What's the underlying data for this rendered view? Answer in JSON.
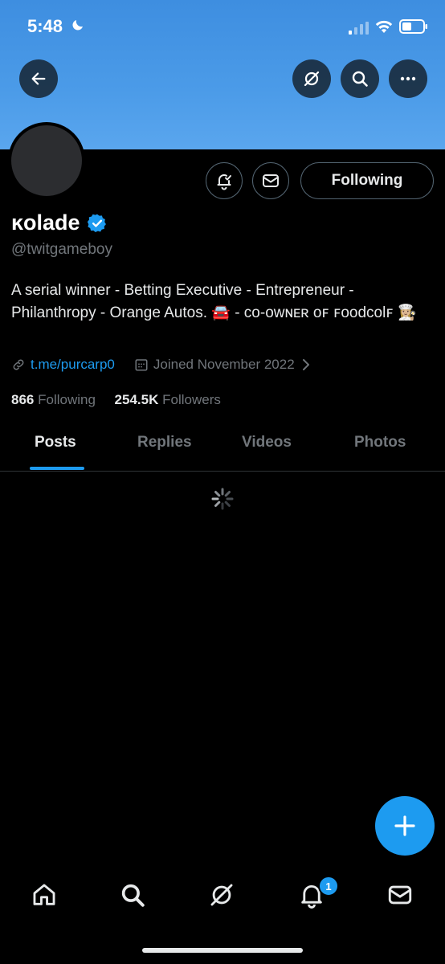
{
  "status_bar": {
    "time": "5:48",
    "icons": [
      "moon-icon",
      "signal-icon",
      "wifi-icon",
      "battery-icon"
    ]
  },
  "header": {
    "icons": [
      "back-arrow-icon",
      "grok-icon",
      "search-icon",
      "more-icon"
    ]
  },
  "profile": {
    "display_name": "ĸolade",
    "handle": "@twitgameboy",
    "verified": true,
    "bio": "A serial winner - Betting Executive - Entrepreneur - Philanthropy - Orange Autos. 🚘 - ᴄᴏ-ᴏᴡɴᴇʀ ᴏꜰ ꜰoodcolꜰ 👩🏼‍🍳",
    "link": "t.me/purcarp0",
    "joined": "Joined November 2022",
    "following_count": "866",
    "following_label": "Following",
    "followers_count": "254.5K",
    "followers_label": "Followers"
  },
  "actions": {
    "following_button": "Following"
  },
  "tabs": [
    {
      "label": "Posts",
      "active": true
    },
    {
      "label": "Replies",
      "active": false
    },
    {
      "label": "Videos",
      "active": false
    },
    {
      "label": "Photos",
      "active": false
    }
  ],
  "bottom_nav": {
    "items": [
      "home-icon",
      "search-icon",
      "grok-icon",
      "notifications-icon",
      "messages-icon"
    ],
    "notification_badge": "1"
  },
  "colors": {
    "accent": "#1d9bf0",
    "banner": "#4b9be8",
    "background": "#000000",
    "muted": "#71767b"
  }
}
